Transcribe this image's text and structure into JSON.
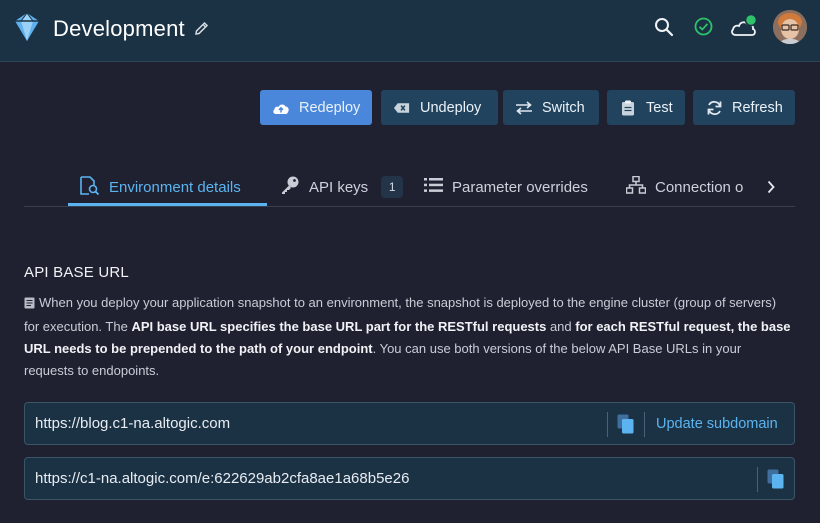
{
  "header": {
    "title": "Development",
    "icons": [
      "logo-icon",
      "pencil-icon",
      "search-icon",
      "check-circle-icon",
      "cloud-online-icon",
      "avatar"
    ],
    "colors": {
      "bar": "#1b3244",
      "status_ok": "#2ec26a"
    }
  },
  "actions": {
    "redeploy": "Redeploy",
    "undeploy": "Undeploy",
    "switch": "Switch",
    "test": "Test",
    "refresh": "Refresh",
    "accent": "#4a87da"
  },
  "tabs": {
    "items": [
      {
        "label": "Environment details",
        "active": true
      },
      {
        "label": "API keys",
        "count": "1"
      },
      {
        "label": "Parameter overrides"
      },
      {
        "label": "Connection o"
      }
    ],
    "active_color": "#5bb4f0"
  },
  "api_base_url": {
    "title": "API BASE URL",
    "desc_1": "When you deploy your application snapshot to an environment, the snapshot is deployed to the engine cluster (group of servers) for execution. The ",
    "desc_bold_1": "API base URL specifies the base URL part for the RESTful requests",
    "desc_2": " and ",
    "desc_bold_2": "for each RESTful request, the base URL needs to be prepended to the path of your endpoint",
    "desc_3": ". You can use both versions of the below API Base URLs in your requests to endopoints.",
    "custom_url": "https://blog.c1-na.altogic.com",
    "update_subdomain": "Update subdomain",
    "env_url": "https://c1-na.altogic.com/e:622629ab2cfa8ae1a68b5e26"
  }
}
